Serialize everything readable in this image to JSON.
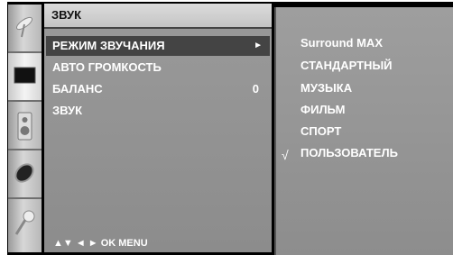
{
  "menu": {
    "title": "ЗВУК",
    "items": [
      {
        "label": "РЕЖИМ ЗВУЧАНИЯ",
        "arrow": "►"
      },
      {
        "label": "АВТО ГРОМКОСТЬ"
      },
      {
        "label": "БАЛАНС",
        "value": "0"
      },
      {
        "label": "ЗВУК"
      }
    ],
    "navigation": "▲▼  ◄ ►  OK  MENU"
  },
  "submenu": {
    "options": [
      "Surround MAX",
      "СТАНДАРТНЫЙ",
      "МУЗЫКА",
      "ФИЛЬМ",
      "СПОРТ",
      "ПОЛЬЗОВАТЕЛЬ"
    ],
    "selected_mark": "√"
  },
  "icons": [
    "satellite-dish-icon",
    "screen-icon",
    "speaker-icon",
    "disc-icon",
    "key-icon"
  ],
  "colors": {
    "panel": "#8f8f8f",
    "selected_row": "#444444",
    "text": "#ffffff"
  }
}
